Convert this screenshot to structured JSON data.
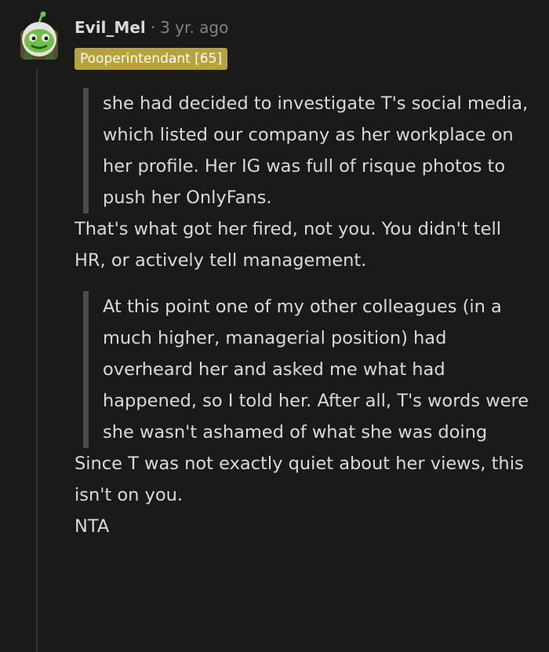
{
  "comment": {
    "author": "Evil_Mel",
    "separator": "·",
    "time": "3 yr. ago",
    "flair": "Pooperintendant [65]",
    "colors": {
      "background": "#1a1a1b",
      "flair_bg": "#b8a23a",
      "text": "#d7dadc",
      "meta": "#818384"
    },
    "avatar_icon": "snoo-avatar-icon",
    "quote1": "she had decided to investigate T's social media, which listed our company as her workplace on her profile. Her IG was full of risque photos to push her OnlyFans.",
    "para1": "That's what got her fired, not you. You didn't tell HR, or actively tell management.",
    "quote2": "At this point one of my other colleagues (in a much higher, managerial position) had overheard her and asked me what had happened, so I told her. After all, T's words were she wasn't ashamed of what she was doing",
    "para2": "Since T was not exactly quiet about her views, this isn't on you.",
    "para3": "NTA"
  }
}
